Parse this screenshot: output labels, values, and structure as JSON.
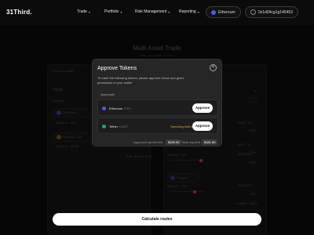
{
  "nav": {
    "logo": "31Third.",
    "items": [
      {
        "label": "Trade",
        "caret": "▾"
      },
      {
        "label": "Portfolio",
        "caret": "▾"
      },
      {
        "label": "Risk Management",
        "caret": "▾"
      },
      {
        "label": "Reporting",
        "caret": "▾"
      }
    ],
    "network": "Ethereum",
    "wallet": "0x1d04cg1g145453"
  },
  "background": {
    "title": "Multi Asset Trade",
    "subtitle": "Trade from token to token",
    "connect_wallet": "Connect wallet",
    "swap": "Swap",
    "you_pay": "You pay",
    "tokens": [
      {
        "name": "Ethereum",
        "balance": "Balance : 5.87"
      },
      {
        "name": "Binance Coin",
        "balance": "Balance : 32.68"
      }
    ],
    "total": "Total : $1,600.15 $",
    "right_values": [
      "$1807.76",
      "50%",
      "$1807.76",
      "50%",
      "$4956.66",
      "50%",
      "$3237.08",
      "33%"
    ],
    "polygon": "Polygon",
    "balance_a": "Balance : 349",
    "balance_b": "Balance : 678",
    "weights": "Weights : 100%",
    "plus": "+",
    "add": "+"
  },
  "modal": {
    "title": "Approve Tokens",
    "close": "×",
    "description": "To trade the following tokens, please approve below and grant permission in your wallet",
    "section_label": "Approvals",
    "tokens": [
      {
        "name": "Ethereum",
        "symbol": "ETH",
        "approve_label": "Approve",
        "warning": ""
      },
      {
        "name": "Tether",
        "symbol": "USDT",
        "approve_label": "Approve",
        "warning": "Spending limit too"
      }
    ],
    "approved_label": "Approved spend limit",
    "approved_value": "$280.05",
    "required_label": "Total required",
    "required_value": "$381.85"
  },
  "cta": {
    "label": "Calculate routes"
  },
  "colors": {
    "eth": "#4a5de0",
    "tether": "#26a17b",
    "bnb": "#f0b90b",
    "polygon": "#8247e5",
    "warning": "#e6a23c"
  }
}
